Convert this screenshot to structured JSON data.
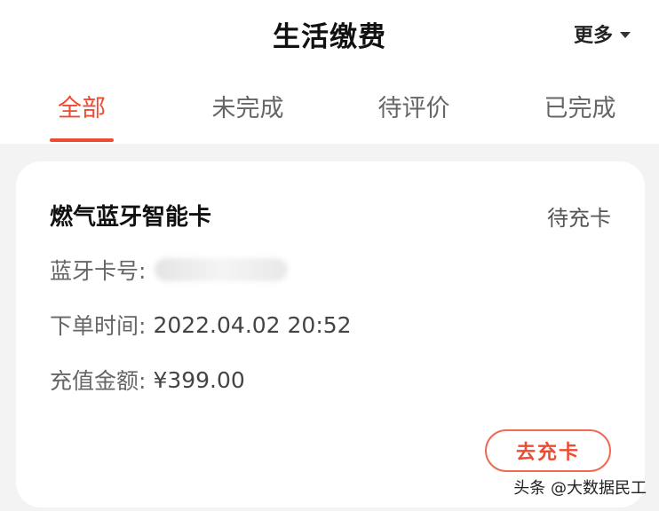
{
  "header": {
    "title": "生活缴费",
    "more_label": "更多"
  },
  "tabs": [
    {
      "label": "全部",
      "active": true
    },
    {
      "label": "未完成",
      "active": false
    },
    {
      "label": "待评价",
      "active": false
    },
    {
      "label": "已完成",
      "active": false
    }
  ],
  "order": {
    "title": "燃气蓝牙智能卡",
    "status": "待充卡",
    "card_no_label": "蓝牙卡号:",
    "order_time_label": "下单时间:",
    "order_time": "2022.04.02 20:52",
    "amount_label": "充值金额:",
    "amount": "¥399.00",
    "action_label": "去充卡"
  },
  "watermark": "头条 @大数据民工",
  "colors": {
    "accent": "#ee4b33",
    "background": "#f3f3f3"
  }
}
